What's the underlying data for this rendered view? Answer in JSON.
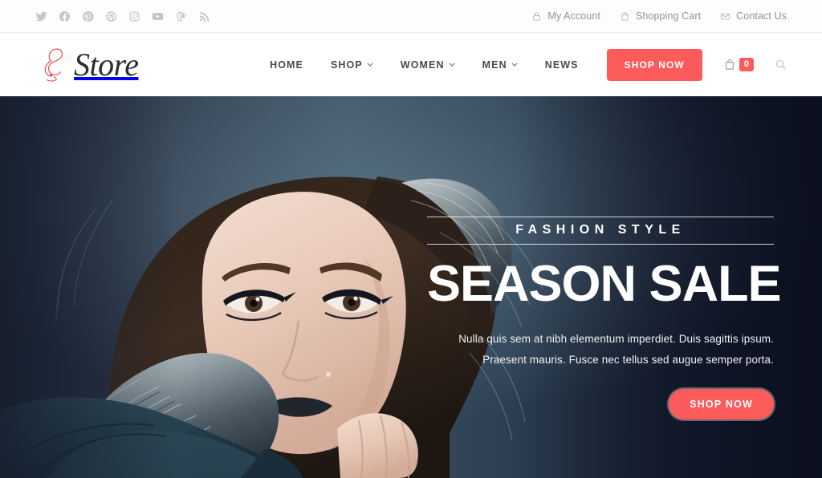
{
  "topbar": {
    "social": [
      {
        "name": "twitter-icon",
        "label": "Twitter"
      },
      {
        "name": "facebook-icon",
        "label": "Facebook"
      },
      {
        "name": "pinterest-icon",
        "label": "Pinterest"
      },
      {
        "name": "dribbble-icon",
        "label": "Dribbble"
      },
      {
        "name": "instagram-icon",
        "label": "Instagram"
      },
      {
        "name": "youtube-icon",
        "label": "YouTube"
      },
      {
        "name": "vine-icon",
        "label": "Vine"
      },
      {
        "name": "rss-icon",
        "label": "RSS"
      }
    ],
    "links": [
      {
        "label": "My Account",
        "icon": "lock-icon"
      },
      {
        "label": "Shopping Cart",
        "icon": "bag-icon"
      },
      {
        "label": "Contact Us",
        "icon": "envelope-icon"
      }
    ]
  },
  "header": {
    "logo_text": "Store",
    "nav": [
      {
        "label": "HOME",
        "has_dropdown": false
      },
      {
        "label": "SHOP",
        "has_dropdown": true
      },
      {
        "label": "WOMEN",
        "has_dropdown": true
      },
      {
        "label": "MEN",
        "has_dropdown": true
      },
      {
        "label": "NEWS",
        "has_dropdown": false
      }
    ],
    "shop_now_label": "SHOP NOW",
    "cart_count": "0",
    "search_label": "Search"
  },
  "hero": {
    "eyebrow": "FASHION STYLE",
    "title": "SEASON SALE",
    "desc_line1": "Nulla quis sem at nibh elementum imperdiet. Duis sagittis ipsum.",
    "desc_line2": "Praesent mauris. Fusce nec tellus sed augue semper porta.",
    "cta_label": "SHOP NOW"
  },
  "colors": {
    "accent": "#fb5b5b",
    "hero_dark": "#121a2a",
    "text_dark": "#4a4a4a",
    "muted": "#8f9490"
  }
}
